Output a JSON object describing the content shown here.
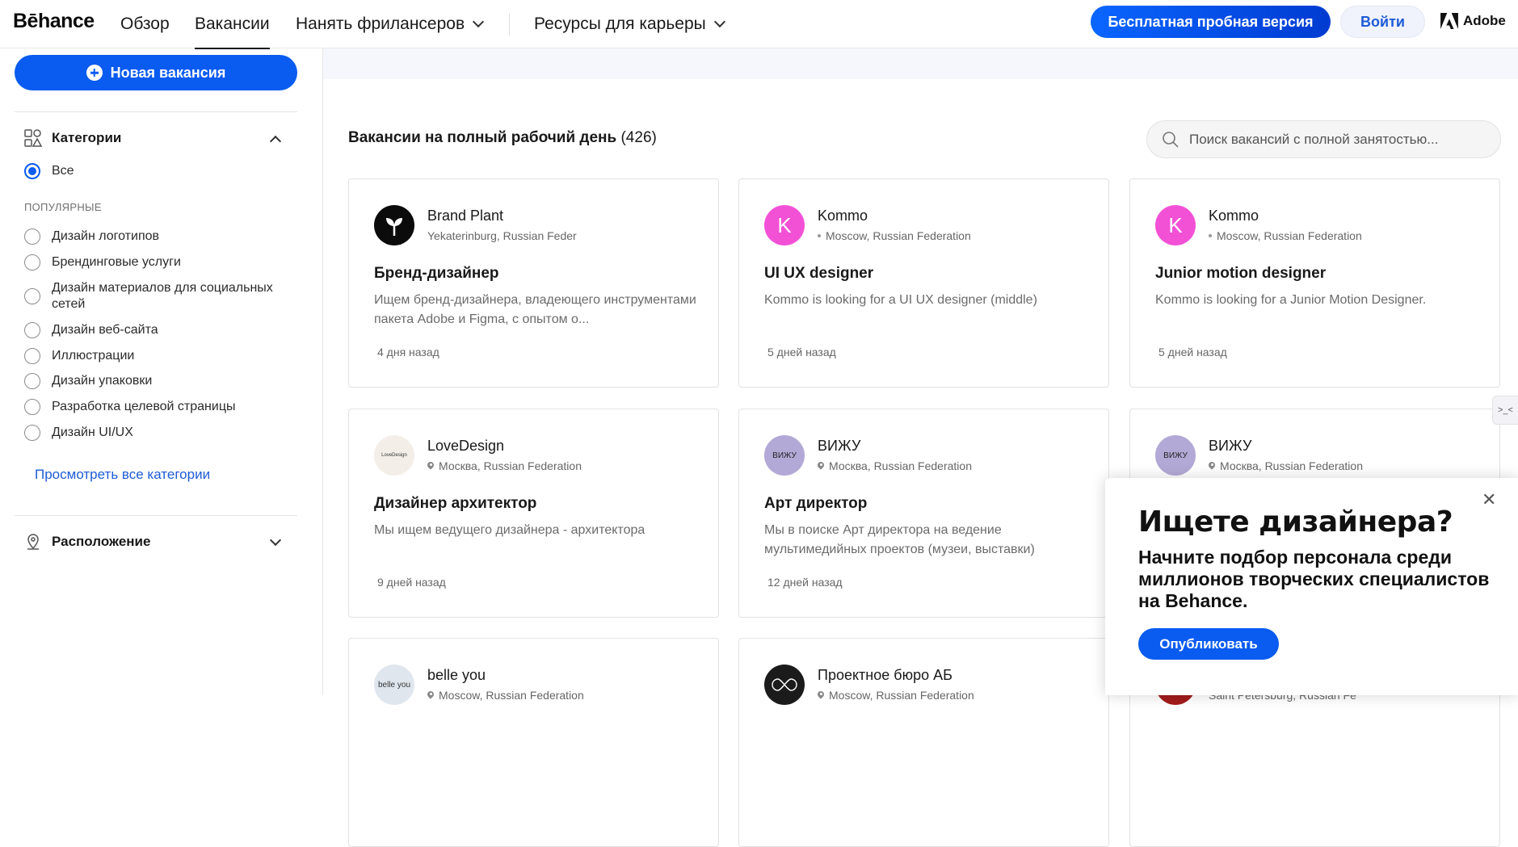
{
  "header": {
    "logo": "Bēhance",
    "nav": [
      "Обзор",
      "Вакансии",
      "Нанять фрилансеров",
      "Ресурсы для карьеры"
    ],
    "trial_button": "Бесплатная пробная версия",
    "login_button": "Войти",
    "adobe": "Adobe"
  },
  "sidebar": {
    "new_job_button": "Новая вакансия",
    "categories_title": "Категории",
    "all_label": "Все",
    "popular_label": "ПОПУЛЯРНЫЕ",
    "categories": [
      "Дизайн логотипов",
      "Брендинговые услуги",
      "Дизайн материалов для социальных сетей",
      "Дизайн веб-сайта",
      "Иллюстрации",
      "Дизайн упаковки",
      "Разработка целевой страницы",
      "Дизайн UI/UX"
    ],
    "view_all": "Просмотреть все категории",
    "location_title": "Расположение"
  },
  "main": {
    "list_title": "Вакансии на полный рабочий день",
    "list_count": "(426)",
    "search_placeholder": "Поиск вакансий с полной занятостью...",
    "jobs": [
      {
        "company": "Brand Plant",
        "location": "Yekaterinburg, Russian Feder",
        "title": "Бренд-дизайнер",
        "desc": "Ищем бренд-дизайнера, владеющего инструментами пакета Adobe и Figma, с опытом о...",
        "when": "4 дня назад",
        "avatar_text": ""
      },
      {
        "company": "Kommo",
        "location": "Moscow, Russian Federation",
        "title": "UI UX designer",
        "desc": "Kommo is looking for a UI UX designer (middle)",
        "when": "5 дней назад",
        "avatar_text": "K"
      },
      {
        "company": "Kommo",
        "location": "Moscow, Russian Federation",
        "title": "Junior motion designer",
        "desc": "Kommo is looking for a Junior Motion Designer.",
        "when": "5 дней назад",
        "avatar_text": "K"
      },
      {
        "company": "LoveDesign",
        "location": "Москва, Russian Federation",
        "title": "Дизайнер архитектор",
        "desc": "Мы ищем ведущего дизайнера - архитектора",
        "when": "9 дней назад",
        "avatar_text": "LoveDesign"
      },
      {
        "company": "ВИЖУ",
        "location": "Москва, Russian Federation",
        "title": "Арт директор",
        "desc": "Мы в поиске Арт директора на ведение мультимедийных проектов (музеи, выставки)",
        "when": "12 дней назад",
        "avatar_text": "ВИЖУ"
      },
      {
        "company": "ВИЖУ",
        "location": "Москва, Russian Federation",
        "title": "",
        "desc": "",
        "when": "",
        "avatar_text": "ВИЖУ"
      },
      {
        "company": "belle you",
        "location": "Moscow, Russian Federation",
        "title": "",
        "desc": "",
        "when": "",
        "avatar_text": "belle you"
      },
      {
        "company": "Проектное бюро АБ",
        "location": "Moscow, Russian Federation",
        "title": "",
        "desc": "",
        "when": "",
        "avatar_text": ""
      },
      {
        "company": "",
        "location": "Saint Petersburg, Russian Fe",
        "title": "",
        "desc": "",
        "when": "",
        "avatar_text": ""
      }
    ]
  },
  "popup": {
    "heading": "Ищете дизайнера?",
    "text": "Начните подбор персонала среди миллионов творческих специалистов на Behance.",
    "button": "Опубликовать"
  },
  "side_tab": ">_<"
}
